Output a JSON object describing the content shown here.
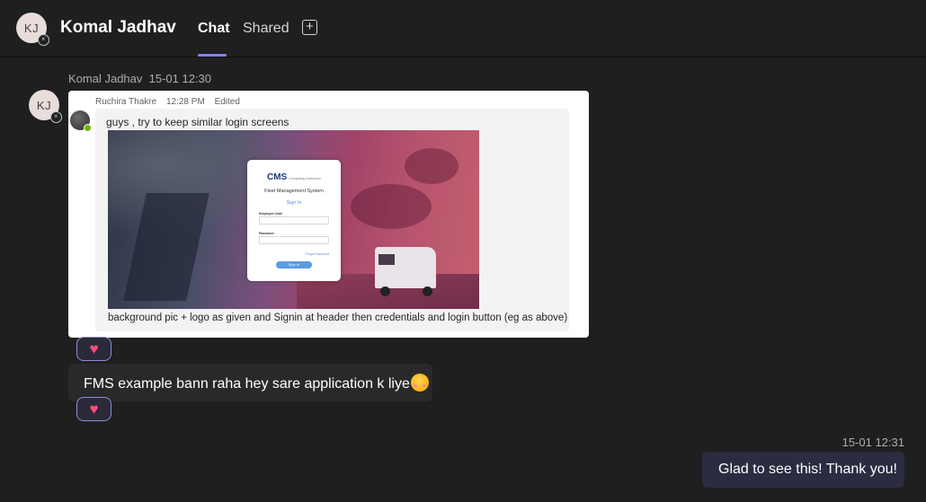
{
  "header": {
    "avatar_initials": "KJ",
    "contact_name": "Komal Jadhav",
    "tabs": [
      {
        "label": "Chat",
        "active": true
      },
      {
        "label": "Shared",
        "active": false
      }
    ],
    "add_tab_icon": "plus-square-icon",
    "accent_color": "#7f85f5"
  },
  "messages": {
    "incoming_meta": {
      "sender": "Komal Jadhav",
      "time": "15-01 12:30"
    },
    "sender_avatar_initials": "KJ",
    "quoted": {
      "author": "Ruchira Thakre",
      "time": "12:28 PM",
      "edited": "Edited",
      "text": "guys , try to keep similar login screens",
      "caption": "background pic + logo as given and Signin at header then credentials and login button (eg as above)",
      "image": {
        "logo": "CMS",
        "logo_tagline": "Connecting Commerce",
        "title": "Fleet Management System",
        "signin_tab": "Sign In",
        "employee_code_label": "Employee Code",
        "password_label": "Password",
        "forgot_password": "Forgot Password",
        "signin_button": "Sign In"
      }
    },
    "reaction_1": {
      "icon": "heart-icon",
      "glyph": "♥"
    },
    "incoming_text": "FMS example bann raha hey sare application k liye",
    "incoming_emoji": "smiling-face-icon",
    "reaction_2": {
      "icon": "heart-icon",
      "glyph": "♥"
    },
    "outgoing_meta": {
      "time": "15-01 12:31"
    },
    "outgoing_text": "Glad to see this! Thank you!"
  }
}
